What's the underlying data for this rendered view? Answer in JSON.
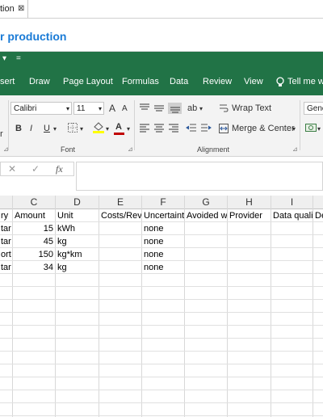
{
  "tab": {
    "label": "tion",
    "close_glyph": "⊠"
  },
  "title": "r production",
  "qat": {
    "items": [
      "▾",
      "="
    ]
  },
  "menu": [
    "sert",
    "Draw",
    "Page Layout",
    "Formulas",
    "Data",
    "Review",
    "View",
    "Tell me wh"
  ],
  "ribbon": {
    "font_name": "Calibri",
    "font_size": "11",
    "grow_glyph": "A",
    "shrink_glyph": "A",
    "bold": "B",
    "italic": "I",
    "underline": "U",
    "font_color_glyph": "A",
    "font_group_label": "Font",
    "wrap_text": "Wrap Text",
    "merge_center": "Merge & Center",
    "alignment_group_label": "Alignment",
    "number_format": "Gene",
    "left_partial": "r"
  },
  "formula_bar": {
    "cancel": "✕",
    "confirm": "✓",
    "fx": "fx"
  },
  "columns": [
    "",
    "C",
    "D",
    "E",
    "F",
    "G",
    "H",
    "I",
    ""
  ],
  "header_row": [
    "ry",
    "Amount",
    "Unit",
    "Costs/Reve",
    "Uncertaint",
    "Avoided w",
    "Provider",
    "Data quali",
    "De"
  ],
  "rows": [
    {
      "a": "tar",
      "amount": "15",
      "unit": "kWh",
      "uncertainty": "none"
    },
    {
      "a": "tar",
      "amount": "45",
      "unit": "kg",
      "uncertainty": "none"
    },
    {
      "a": "ort",
      "amount": "150",
      "unit": "kg*km",
      "uncertainty": "none"
    },
    {
      "a": "tar",
      "amount": "34",
      "unit": "kg",
      "uncertainty": "none"
    }
  ],
  "colors": {
    "excel_green": "#217346",
    "title_blue": "#1a7bd6",
    "font_color_red": "#c00000",
    "fill_yellow": "#ffff00"
  }
}
